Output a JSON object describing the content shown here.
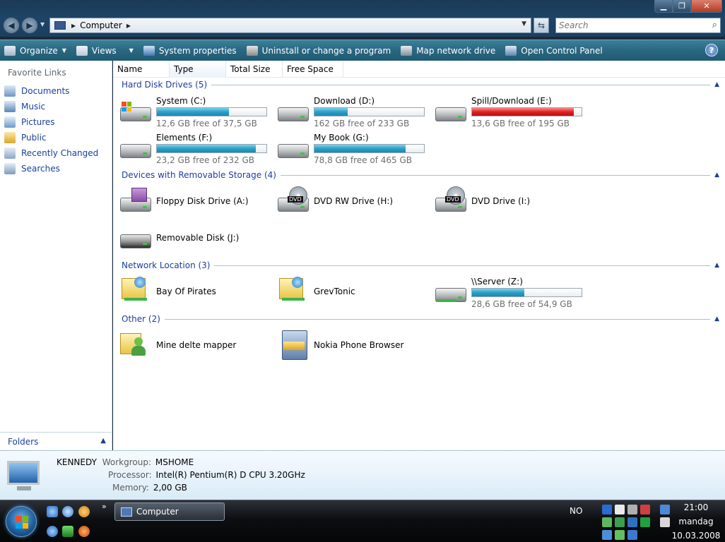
{
  "window": {
    "minimize_glyph": "▁",
    "maximize_glyph": "❐",
    "close_glyph": "✕"
  },
  "address": {
    "breadcrumb": "Computer",
    "search_placeholder": "Search"
  },
  "toolbar": {
    "organize": "Organize",
    "views": "Views",
    "system_properties": "System properties",
    "uninstall": "Uninstall or change a program",
    "map_network": "Map network drive",
    "control_panel": "Open Control Panel",
    "help": "?"
  },
  "left_pane": {
    "title": "Favorite Links",
    "links": [
      "Documents",
      "Music",
      "Pictures",
      "Public",
      "Recently Changed",
      "Searches"
    ],
    "folders_label": "Folders"
  },
  "columns": [
    "Name",
    "Type",
    "Total Size",
    "Free Space"
  ],
  "groups": {
    "hard_disks": "Hard Disk Drives (5)",
    "removable": "Devices with Removable Storage (4)",
    "network": "Network Location (3)",
    "other": "Other (2)"
  },
  "hard_drives": [
    {
      "label": "System (C:)",
      "free": "12,6 GB free of 37,5 GB",
      "used_fraction": 0.66,
      "color": "#2aa0c8"
    },
    {
      "label": "Download (D:)",
      "free": "162 GB free of 233 GB",
      "used_fraction": 0.3,
      "color": "#2aa0c8"
    },
    {
      "label": "Spill/Download (E:)",
      "free": "13,6 GB free of 195 GB",
      "used_fraction": 0.93,
      "color": "#e02020"
    },
    {
      "label": "Elements (F:)",
      "free": "23,2 GB free of 232 GB",
      "used_fraction": 0.9,
      "color": "#2aa0c8"
    },
    {
      "label": "My Book (G:)",
      "free": "78,8 GB free of 465 GB",
      "used_fraction": 0.83,
      "color": "#2aa0c8"
    }
  ],
  "removable": [
    "Floppy Disk Drive (A:)",
    "DVD RW Drive (H:)",
    "DVD Drive (I:)",
    "Removable Disk (J:)"
  ],
  "dvd_badge": "DVD",
  "network": [
    {
      "label": "Bay Of Pirates"
    },
    {
      "label": "GrevTonic"
    },
    {
      "label": "\\\\Server (Z:)",
      "free": "28,6 GB free of 54,9 GB",
      "used_fraction": 0.48
    }
  ],
  "other": [
    "Mine delte mapper",
    "Nokia Phone Browser"
  ],
  "details": {
    "computer_name": "KENNEDY",
    "workgroup_label": "Workgroup:",
    "workgroup": "MSHOME",
    "processor_label": "Processor:",
    "processor": "Intel(R) Pentium(R) D CPU 3.20GHz",
    "memory_label": "Memory:",
    "memory": "2,00 GB"
  },
  "taskbar": {
    "task_label": "Computer",
    "language": "NO",
    "time": "21:00",
    "day": "mandag",
    "date": "10.03.2008",
    "overflow": "»"
  }
}
